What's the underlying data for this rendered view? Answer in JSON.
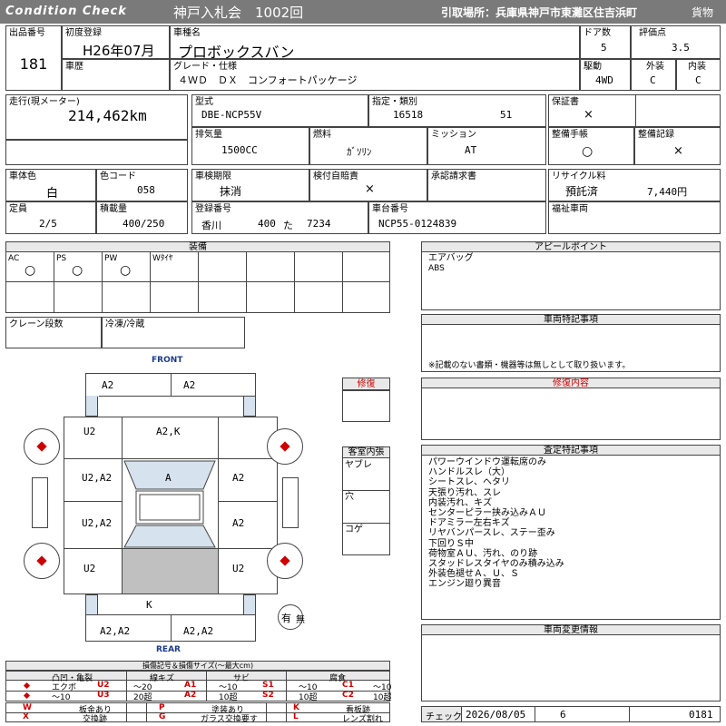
{
  "header": {
    "title_left": "Condition Check",
    "title_mid": "神戸入札会　1002回",
    "pickup": "引取場所：兵庫県神戸市東灘区住吉浜町",
    "category": "貨物"
  },
  "row1": {
    "lot_label": "出品番号",
    "lot": "181",
    "first_reg_label": "初度登録",
    "first_reg": "H26年07月",
    "model_label": "車種名",
    "model": "プロボックスバン",
    "doors_label": "ドア数",
    "doors": "5",
    "score_label": "評価点",
    "score": "3.5",
    "history_label": "車歴",
    "grade_label": "グレード・仕様",
    "grade": "４ＷＤ　ＤＸ　コンフォートパッケージ",
    "drive_label": "駆動",
    "drive": "4WD",
    "exterior_label": "外装",
    "exterior": "C",
    "interior_label": "内装",
    "interior": "C"
  },
  "row2": {
    "mileage_label": "走行(現メーター)",
    "mileage": "214,462km",
    "type_label": "型式",
    "type": "DBE-NCP55V",
    "designation_label": "指定・類別",
    "designation": "16518",
    "category_no": "51",
    "warranty_label": "保証書",
    "warranty": "×",
    "displacement_label": "排気量",
    "displacement": "1500CC",
    "fuel_label": "燃料",
    "fuel": "ｶﾞｿﾘﾝ",
    "mission_label": "ミッション",
    "mission": "AT",
    "maint_book_label": "整備手帳",
    "maint_book": "○",
    "maint_record_label": "整備記録",
    "maint_record": "×"
  },
  "row3": {
    "body_color_label": "車体色",
    "body_color": "白",
    "color_code_label": "色コード",
    "color_code": "058",
    "inspection_label": "車検期限",
    "inspection": "抹消",
    "self_sign_label": "検付自賠責",
    "self_sign": "×",
    "approval_label": "承認請求書",
    "recycle_label": "リサイクル料",
    "recycle_status": "預託済",
    "recycle_fee": "7,440円",
    "capacity_label": "定員",
    "capacity": "2/5",
    "load_label": "積載量",
    "load": "400/250",
    "reg_no_label": "登録番号",
    "reg_area": "香川",
    "reg_class": "400",
    "reg_kana": "た",
    "reg_num": "7234",
    "chassis_label": "車台番号",
    "chassis": "NCP55-0124839",
    "welfare_label": "福祉車両"
  },
  "equipment": {
    "title": "装備",
    "items": [
      {
        "label": "AC",
        "mark": "○"
      },
      {
        "label": "PS",
        "mark": "○"
      },
      {
        "label": "PW",
        "mark": "○"
      },
      {
        "label": "Wﾀｲﾔ",
        "mark": ""
      }
    ],
    "crane_label": "クレーン段数",
    "refrig_label": "冷凍/冷蔵"
  },
  "appeal": {
    "title": "アピールポイント",
    "lines": [
      "エアバッグ",
      "ABS"
    ]
  },
  "special_notes": {
    "title": "車両特記事項",
    "note": "※記載のない書類・機器等は無しとして取り扱います。"
  },
  "repair": {
    "title": "修復",
    "content_title": "修復内容"
  },
  "cabin": {
    "title": "客室内張",
    "items": [
      "ヤブレ",
      "穴",
      "コゲ"
    ]
  },
  "inspection_notes": {
    "title": "査定特記事項",
    "lines": [
      "パワーウインドウ運転席のみ",
      "ハンドルスレ（大）",
      "シートスレ、ヘタリ",
      "天張り汚れ、スレ",
      "内装汚れ、キズ",
      "センターピラー挟み込みＡＵ",
      "ドアミラー左右キズ",
      "リヤバンパースレ、ステー歪み",
      "下回りＳ中",
      "荷物室ＡＵ、汚れ、のり跡",
      "スタッドレスタイヤのみ積み込み",
      "外装色褪せＡ、Ｕ、Ｓ",
      "エンジン廻り異音"
    ]
  },
  "change_info": {
    "title": "車両変更情報"
  },
  "diagram": {
    "front": "FRONT",
    "rear": "REAR",
    "marks": {
      "front_left": "A2",
      "front_right": "A2",
      "hood_left": "U2",
      "hood_center": "A2,K",
      "fl_door": "U2,A2",
      "roof_front": "A",
      "fr_door": "A2",
      "rl_door": "U2,A2",
      "rr_door": "A2",
      "rear_left": "U2",
      "rear_right": "U2",
      "rear_center": "K",
      "bumper_left": "A2,A2",
      "bumper_right": "A2,A2"
    },
    "spare": "有",
    "spare_none": "無"
  },
  "legend": {
    "title": "損傷記号＆損傷サイズ(～最大cm)",
    "headers": [
      "凸凹・亀裂",
      "線キズ",
      "サビ",
      "腐食"
    ],
    "row1": [
      "エクボ",
      "U2",
      "～20",
      "A1",
      "～10",
      "S1",
      "～10",
      "C1",
      "～10"
    ],
    "row2": [
      "～10",
      "U3",
      "20超",
      "A2",
      "10超",
      "S2",
      "10超",
      "C2",
      "10超"
    ],
    "codes": [
      {
        "code": "W",
        "text": "板金あり"
      },
      {
        "code": "P",
        "text": "塗装あり"
      },
      {
        "code": "K",
        "text": "看板跡"
      },
      {
        "code": "X",
        "text": "交換跡"
      },
      {
        "code": "G",
        "text": "ガラス交換要す"
      },
      {
        "code": "L",
        "text": "レンズ割れ"
      }
    ]
  },
  "footer": {
    "check_label": "チェック",
    "date": "2026/08/05",
    "checker": "6",
    "code": "0181"
  }
}
